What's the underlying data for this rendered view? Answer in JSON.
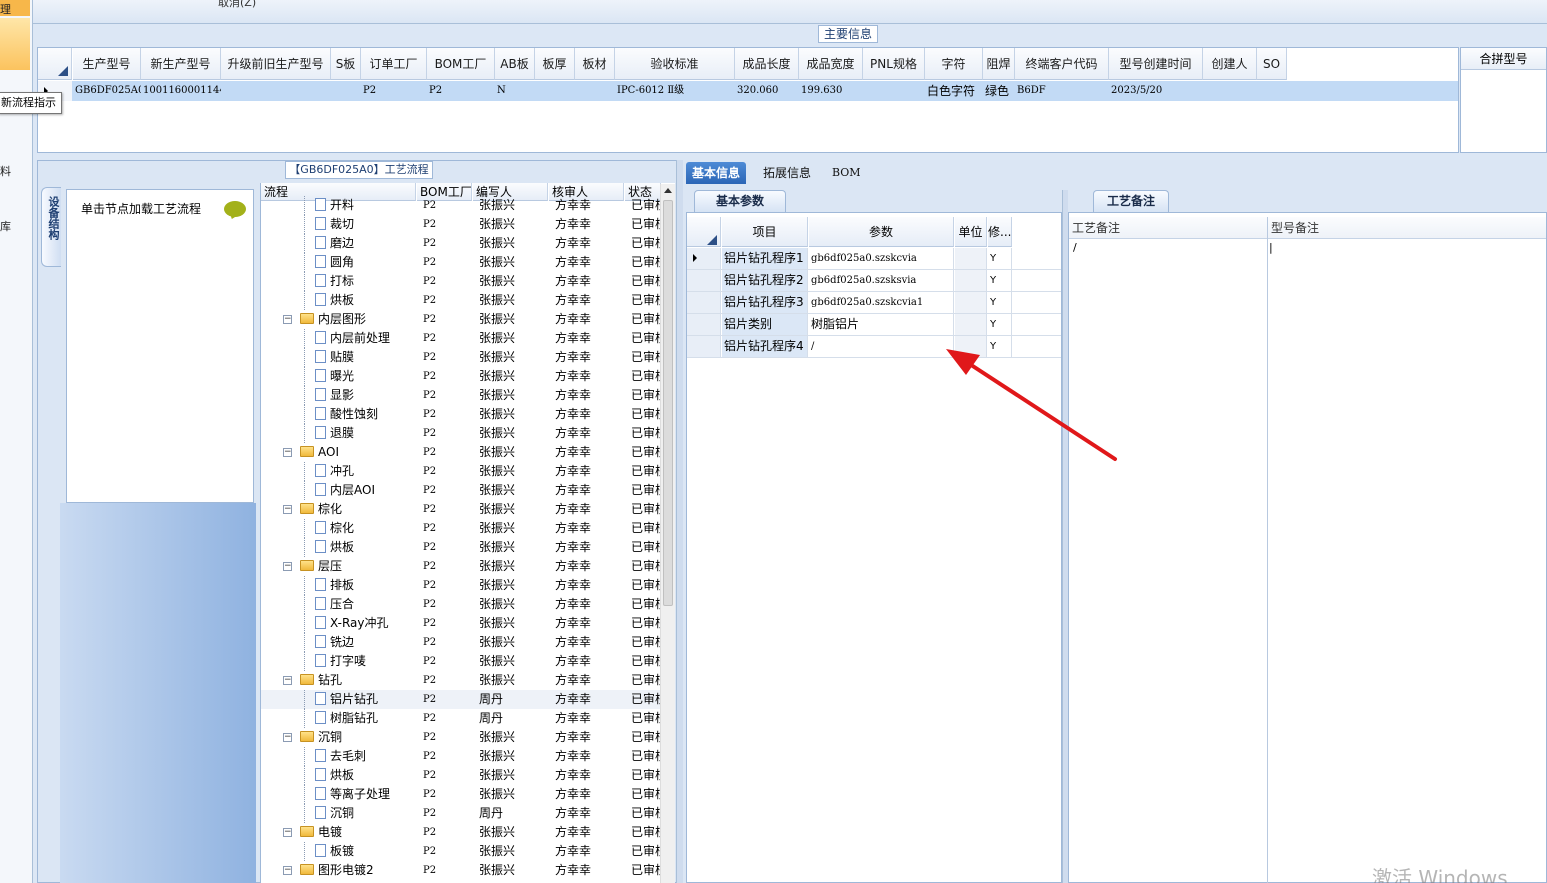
{
  "left_strip": {
    "labels": [
      "理",
      "料",
      "库"
    ]
  },
  "tooltip": "新流程指示",
  "toolbar": {
    "cancel_label": "取消(Z)"
  },
  "main_info": {
    "title": "主要信息",
    "columns": [
      "生产型号",
      "新生产型号",
      "升级前旧生产型号",
      "S板",
      "订单工厂",
      "BOM工厂",
      "AB板",
      "板厚",
      "板材",
      "验收标准",
      "成品长度",
      "成品宽度",
      "PNL规格",
      "字符",
      "阻焊",
      "终端客户代码",
      "型号创建时间",
      "创建人",
      "SO"
    ],
    "row": [
      "GB6DF025A0",
      "10011600011442",
      "",
      "",
      "P2",
      "P2",
      "N",
      "",
      "",
      "IPC-6012 Ⅱ级",
      "320.060",
      "199.630",
      "",
      "白色字符",
      "绿色",
      "B6DF",
      "2023/5/20",
      "",
      ""
    ],
    "merge_header": "合拼型号"
  },
  "process": {
    "title": "【GB6DF025A0】工艺流程",
    "side_tab": "设备结构",
    "load_hint": "单击节点加载工艺流程",
    "columns": [
      "流程",
      "BOM工厂",
      "编写人",
      "核审人",
      "状态"
    ],
    "rows": [
      {
        "name": "开料",
        "type": "leaf",
        "factory": "P2",
        "writer": "张振兴",
        "reviewer": "方幸幸",
        "status": "已审核"
      },
      {
        "name": "裁切",
        "type": "leaf",
        "factory": "P2",
        "writer": "张振兴",
        "reviewer": "方幸幸",
        "status": "已审核"
      },
      {
        "name": "磨边",
        "type": "leaf",
        "factory": "P2",
        "writer": "张振兴",
        "reviewer": "方幸幸",
        "status": "已审核"
      },
      {
        "name": "圆角",
        "type": "leaf",
        "factory": "P2",
        "writer": "张振兴",
        "reviewer": "方幸幸",
        "status": "已审核"
      },
      {
        "name": "打标",
        "type": "leaf",
        "factory": "P2",
        "writer": "张振兴",
        "reviewer": "方幸幸",
        "status": "已审核"
      },
      {
        "name": "烘板",
        "type": "leaf",
        "factory": "P2",
        "writer": "张振兴",
        "reviewer": "方幸幸",
        "status": "已审核"
      },
      {
        "name": "内层图形",
        "type": "folder",
        "factory": "P2",
        "writer": "张振兴",
        "reviewer": "方幸幸",
        "status": "已审核"
      },
      {
        "name": "内层前处理",
        "type": "leaf",
        "factory": "P2",
        "writer": "张振兴",
        "reviewer": "方幸幸",
        "status": "已审核"
      },
      {
        "name": "贴膜",
        "type": "leaf",
        "factory": "P2",
        "writer": "张振兴",
        "reviewer": "方幸幸",
        "status": "已审核"
      },
      {
        "name": "曝光",
        "type": "leaf",
        "factory": "P2",
        "writer": "张振兴",
        "reviewer": "方幸幸",
        "status": "已审核"
      },
      {
        "name": "显影",
        "type": "leaf",
        "factory": "P2",
        "writer": "张振兴",
        "reviewer": "方幸幸",
        "status": "已审核"
      },
      {
        "name": "酸性蚀刻",
        "type": "leaf",
        "factory": "P2",
        "writer": "张振兴",
        "reviewer": "方幸幸",
        "status": "已审核"
      },
      {
        "name": "退膜",
        "type": "leaf",
        "factory": "P2",
        "writer": "张振兴",
        "reviewer": "方幸幸",
        "status": "已审核"
      },
      {
        "name": "AOI",
        "type": "folder",
        "factory": "P2",
        "writer": "张振兴",
        "reviewer": "方幸幸",
        "status": "已审核"
      },
      {
        "name": "冲孔",
        "type": "leaf",
        "factory": "P2",
        "writer": "张振兴",
        "reviewer": "方幸幸",
        "status": "已审核"
      },
      {
        "name": "内层AOI",
        "type": "leaf",
        "factory": "P2",
        "writer": "张振兴",
        "reviewer": "方幸幸",
        "status": "已审核"
      },
      {
        "name": "棕化",
        "type": "folder",
        "factory": "P2",
        "writer": "张振兴",
        "reviewer": "方幸幸",
        "status": "已审核"
      },
      {
        "name": "棕化",
        "type": "leaf",
        "factory": "P2",
        "writer": "张振兴",
        "reviewer": "方幸幸",
        "status": "已审核"
      },
      {
        "name": "烘板",
        "type": "leaf",
        "factory": "P2",
        "writer": "张振兴",
        "reviewer": "方幸幸",
        "status": "已审核"
      },
      {
        "name": "层压",
        "type": "folder",
        "factory": "P2",
        "writer": "张振兴",
        "reviewer": "方幸幸",
        "status": "已审核"
      },
      {
        "name": "排板",
        "type": "leaf",
        "factory": "P2",
        "writer": "张振兴",
        "reviewer": "方幸幸",
        "status": "已审核"
      },
      {
        "name": "压合",
        "type": "leaf",
        "factory": "P2",
        "writer": "张振兴",
        "reviewer": "方幸幸",
        "status": "已审核"
      },
      {
        "name": "X-Ray冲孔",
        "type": "leaf",
        "factory": "P2",
        "writer": "张振兴",
        "reviewer": "方幸幸",
        "status": "已审核"
      },
      {
        "name": "铣边",
        "type": "leaf",
        "factory": "P2",
        "writer": "张振兴",
        "reviewer": "方幸幸",
        "status": "已审核"
      },
      {
        "name": "打字唛",
        "type": "leaf",
        "factory": "P2",
        "writer": "张振兴",
        "reviewer": "方幸幸",
        "status": "已审核"
      },
      {
        "name": "钻孔",
        "type": "folder",
        "factory": "P2",
        "writer": "张振兴",
        "reviewer": "方幸幸",
        "status": "已审核"
      },
      {
        "name": "铝片钻孔",
        "type": "leaf",
        "factory": "P2",
        "writer": "周丹",
        "reviewer": "方幸幸",
        "status": "已审核",
        "selected": true
      },
      {
        "name": "树脂钻孔",
        "type": "leaf",
        "factory": "P2",
        "writer": "周丹",
        "reviewer": "方幸幸",
        "status": "已审核"
      },
      {
        "name": "沉铜",
        "type": "folder",
        "factory": "P2",
        "writer": "张振兴",
        "reviewer": "方幸幸",
        "status": "已审核"
      },
      {
        "name": "去毛刺",
        "type": "leaf",
        "factory": "P2",
        "writer": "张振兴",
        "reviewer": "方幸幸",
        "status": "已审核"
      },
      {
        "name": "烘板",
        "type": "leaf",
        "factory": "P2",
        "writer": "张振兴",
        "reviewer": "方幸幸",
        "status": "已审核"
      },
      {
        "name": "等离子处理",
        "type": "leaf",
        "factory": "P2",
        "writer": "张振兴",
        "reviewer": "方幸幸",
        "status": "已审核"
      },
      {
        "name": "沉铜",
        "type": "leaf",
        "factory": "P2",
        "writer": "周丹",
        "reviewer": "方幸幸",
        "status": "已审核"
      },
      {
        "name": "电镀",
        "type": "folder",
        "factory": "P2",
        "writer": "张振兴",
        "reviewer": "方幸幸",
        "status": "已审核"
      },
      {
        "name": "板镀",
        "type": "leaf",
        "factory": "P2",
        "writer": "张振兴",
        "reviewer": "方幸幸",
        "status": "已审核"
      },
      {
        "name": "图形电镀2",
        "type": "folder",
        "factory": "P2",
        "writer": "张振兴",
        "reviewer": "方幸幸",
        "status": "已审核"
      }
    ]
  },
  "tabs": [
    "基本信息",
    "拓展信息",
    "BOM"
  ],
  "basic_params": {
    "tab_label": "基本参数",
    "columns": [
      "项目",
      "参数",
      "单位",
      "修..."
    ],
    "rows": [
      {
        "item": "铝片钻孔程序1",
        "value": "gb6df025a0.szskcvia",
        "unit": "",
        "mod": "Y"
      },
      {
        "item": "铝片钻孔程序2",
        "value": "gb6df025a0.szsksvia",
        "unit": "",
        "mod": "Y"
      },
      {
        "item": "铝片钻孔程序3",
        "value": "gb6df025a0.szskcvia1",
        "unit": "",
        "mod": "Y"
      },
      {
        "item": "铝片类别",
        "value": "树脂铝片",
        "unit": "",
        "mod": "Y"
      },
      {
        "item": "铝片钻孔程序4",
        "value": "/",
        "unit": "",
        "mod": "Y"
      }
    ]
  },
  "notes": {
    "tab_label": "工艺备注",
    "col1": "工艺备注",
    "col2": "型号备注",
    "col1_value": "/",
    "col2_value": "|"
  },
  "watermark": "激活 Windows",
  "colors": {
    "selection": "#c2daf5",
    "tab_active": "#2c66b6",
    "arrow": "#e0181a"
  }
}
